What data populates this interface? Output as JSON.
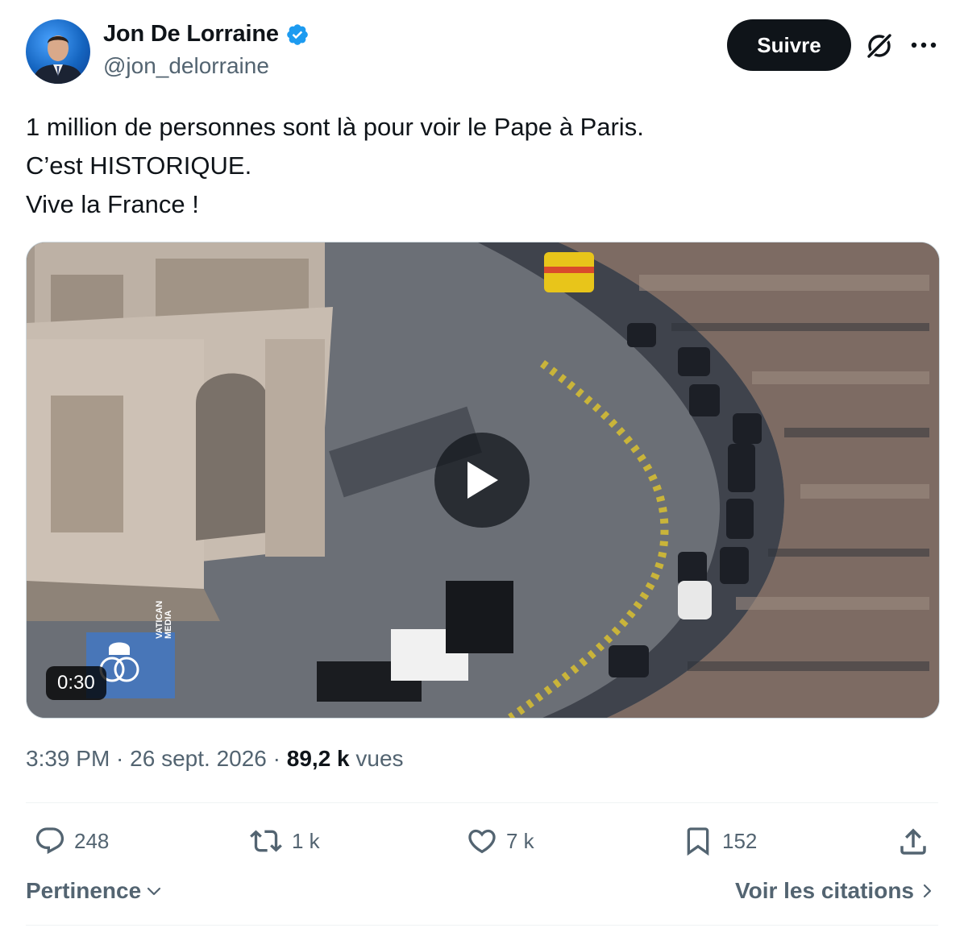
{
  "author": {
    "display_name": "Jon De Lorraine",
    "handle": "@jon_delorraine",
    "verified": true,
    "verified_color": "#1d9bf0"
  },
  "header": {
    "follow_label": "Suivre",
    "icons": [
      "grok-icon",
      "more-icon"
    ]
  },
  "tweet": {
    "lines": [
      "1 million de personnes sont là pour voir le Pape à Paris.",
      "C’est HISTORIQUE.",
      "Vive la France !"
    ]
  },
  "media": {
    "duration": "0:30",
    "watermark": "VATICAN MEDIA"
  },
  "meta": {
    "time": "3:39 PM",
    "separator": " · ",
    "date": "26 sept. 2026",
    "views_count": "89,2 k",
    "views_label": " vues"
  },
  "actions": {
    "replies": "248",
    "reposts": "1 k",
    "likes": "7 k",
    "bookmarks": "152"
  },
  "footer": {
    "sort_label": "Pertinence",
    "quotes_label": "Voir les citations"
  },
  "colors": {
    "text_primary": "#0f1419",
    "text_secondary": "#536471",
    "button_dark": "#0f1419",
    "divider": "#eff3f4"
  }
}
